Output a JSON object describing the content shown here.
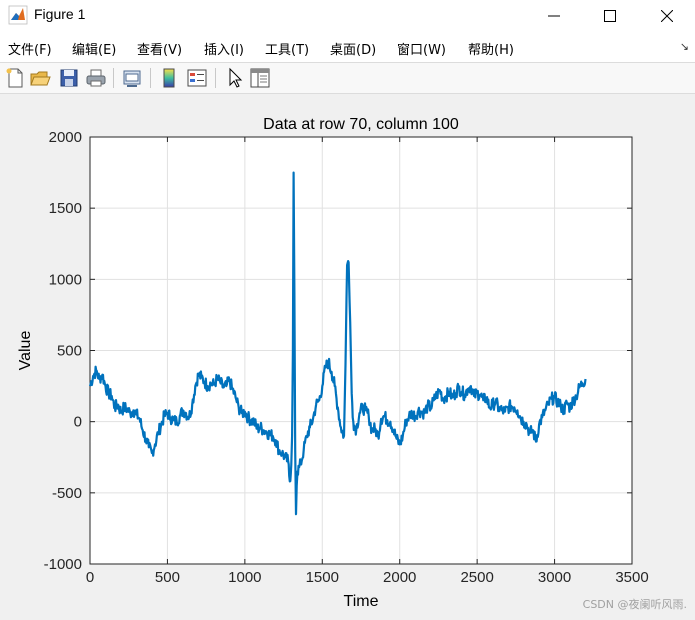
{
  "window": {
    "title": "Figure 1",
    "icon": "matlab-icon",
    "controls": [
      "minimize-icon",
      "maximize-icon",
      "close-icon"
    ]
  },
  "menu": {
    "items": [
      {
        "label": "文件(F)"
      },
      {
        "label": "编辑(E)"
      },
      {
        "label": "查看(V)"
      },
      {
        "label": "插入(I)"
      },
      {
        "label": "工具(T)"
      },
      {
        "label": "桌面(D)"
      },
      {
        "label": "窗口(W)"
      },
      {
        "label": "帮助(H)"
      }
    ],
    "overflow_icon": "arrow-icon"
  },
  "toolbar": {
    "buttons": [
      "new-figure-icon",
      "open-file-icon",
      "save-icon",
      "print-icon",
      "link-plot-icon",
      "insert-colorbar-icon",
      "insert-legend-icon",
      "edit-plot-icon",
      "property-editor-icon"
    ]
  },
  "chart_data": {
    "type": "line",
    "title": "Data at row 70, column 100",
    "xlabel": "Time",
    "ylabel": "Value",
    "xlim": [
      0,
      3500
    ],
    "ylim": [
      -1000,
      2000
    ],
    "xticks": [
      0,
      500,
      1000,
      1500,
      2000,
      2500,
      3000,
      3500
    ],
    "yticks": [
      -1000,
      -500,
      0,
      500,
      1000,
      1500,
      2000
    ],
    "xtick_labels": [
      "0",
      "500",
      "1000",
      "1500",
      "2000",
      "2500",
      "3000",
      "3500"
    ],
    "ytick_labels": [
      "-1000",
      "-500",
      "0",
      "500",
      "1000",
      "1500",
      "2000"
    ],
    "grid": true,
    "series_color": "#0072bd",
    "series": [
      {
        "x": [
          0,
          20,
          40,
          60,
          80,
          100,
          120,
          140,
          160,
          180,
          200,
          220,
          240,
          260,
          280,
          300,
          320,
          340,
          360,
          380,
          400,
          420,
          440,
          460,
          480,
          500,
          520,
          540,
          560,
          580,
          600,
          620,
          640,
          660,
          680,
          700,
          720,
          740,
          760,
          780,
          800,
          820,
          840,
          860,
          880,
          900,
          920,
          940,
          960,
          980,
          1000,
          1020,
          1040,
          1060,
          1080,
          1100,
          1120,
          1140,
          1160,
          1180,
          1200,
          1220,
          1240,
          1260,
          1280,
          1290,
          1300,
          1305,
          1310,
          1315,
          1320,
          1325,
          1330,
          1335,
          1340,
          1350,
          1360,
          1380,
          1400,
          1420,
          1440,
          1460,
          1480,
          1500,
          1520,
          1540,
          1560,
          1580,
          1600,
          1620,
          1640,
          1650,
          1660,
          1670,
          1680,
          1690,
          1700,
          1710,
          1720,
          1740,
          1760,
          1780,
          1800,
          1820,
          1840,
          1860,
          1880,
          1900,
          1920,
          1940,
          1960,
          1980,
          2000,
          2020,
          2040,
          2060,
          2080,
          2100,
          2120,
          2140,
          2160,
          2180,
          2200,
          2220,
          2240,
          2260,
          2280,
          2300,
          2320,
          2340,
          2360,
          2380,
          2400,
          2420,
          2440,
          2460,
          2480,
          2500,
          2520,
          2540,
          2560,
          2580,
          2600,
          2620,
          2640,
          2660,
          2680,
          2700,
          2720,
          2740,
          2760,
          2780,
          2800,
          2820,
          2840,
          2860,
          2880,
          2900,
          2920,
          2940,
          2960,
          2980,
          3000,
          3020,
          3040,
          3060,
          3080,
          3100,
          3120,
          3140,
          3160,
          3180,
          3200
        ],
        "y": [
          250,
          320,
          360,
          300,
          330,
          250,
          200,
          180,
          100,
          120,
          70,
          100,
          90,
          60,
          80,
          50,
          20,
          -60,
          -120,
          -180,
          -220,
          -160,
          -80,
          -20,
          40,
          60,
          30,
          10,
          0,
          40,
          80,
          60,
          30,
          120,
          250,
          330,
          310,
          280,
          250,
          270,
          260,
          300,
          280,
          240,
          250,
          290,
          230,
          170,
          100,
          60,
          70,
          30,
          10,
          0,
          -50,
          -40,
          -60,
          -70,
          -90,
          -100,
          -130,
          -200,
          -220,
          -250,
          -280,
          -420,
          -300,
          -100,
          500,
          1750,
          900,
          -200,
          -650,
          -450,
          -350,
          -320,
          -300,
          -200,
          -100,
          -40,
          20,
          120,
          150,
          250,
          380,
          420,
          350,
          250,
          100,
          -40,
          -100,
          400,
          1100,
          1120,
          700,
          200,
          0,
          -40,
          -50,
          60,
          100,
          80,
          40,
          -60,
          -50,
          -100,
          20,
          40,
          10,
          0,
          -60,
          -120,
          -160,
          -100,
          0,
          40,
          60,
          40,
          80,
          70,
          60,
          110,
          100,
          150,
          190,
          220,
          160,
          180,
          210,
          170,
          200,
          240,
          210,
          190,
          230,
          250,
          180,
          200,
          190,
          150,
          170,
          100,
          120,
          140,
          90,
          80,
          70,
          100,
          110,
          100,
          80,
          30,
          0,
          -20,
          -80,
          -60,
          -140,
          -20,
          30,
          80,
          120,
          160,
          170,
          140,
          110,
          80,
          130,
          100,
          150,
          180,
          240,
          270,
          300
        ]
      }
    ]
  },
  "watermark": "CSDN @夜阑听风雨."
}
